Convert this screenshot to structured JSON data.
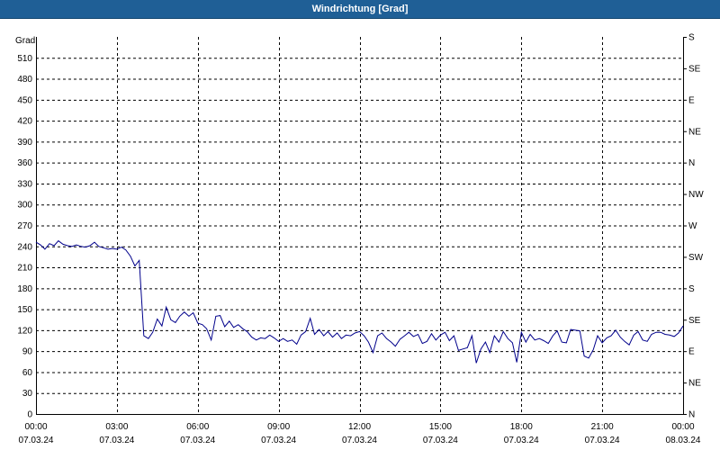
{
  "window": {
    "title": "Windrichtung [Grad]"
  },
  "colors": {
    "line": "#00008b",
    "grid": "#000000",
    "titlebar": "#1f5f96"
  },
  "chart_data": {
    "type": "line",
    "title": "Windrichtung [Grad]",
    "ylabel": "Grad",
    "ylim": [
      0,
      540
    ],
    "y_ticks": [
      0,
      30,
      60,
      90,
      120,
      150,
      180,
      210,
      240,
      270,
      300,
      330,
      360,
      390,
      420,
      450,
      480,
      510
    ],
    "y2_ticks": [
      {
        "value": 0,
        "label": "N"
      },
      {
        "value": 45,
        "label": "NE"
      },
      {
        "value": 90,
        "label": "E"
      },
      {
        "value": 135,
        "label": "SE"
      },
      {
        "value": 180,
        "label": "S"
      },
      {
        "value": 225,
        "label": "SW"
      },
      {
        "value": 270,
        "label": "W"
      },
      {
        "value": 315,
        "label": "NW"
      },
      {
        "value": 360,
        "label": "N"
      },
      {
        "value": 405,
        "label": "NE"
      },
      {
        "value": 450,
        "label": "E"
      },
      {
        "value": 495,
        "label": "SE"
      },
      {
        "value": 540,
        "label": "S"
      }
    ],
    "xlim": [
      0,
      24
    ],
    "x_ticks": [
      {
        "value": 0,
        "time": "00:00",
        "date": "07.03.24"
      },
      {
        "value": 3,
        "time": "03:00",
        "date": "07.03.24"
      },
      {
        "value": 6,
        "time": "06:00",
        "date": "07.03.24"
      },
      {
        "value": 9,
        "time": "09:00",
        "date": "07.03.24"
      },
      {
        "value": 12,
        "time": "12:00",
        "date": "07.03.24"
      },
      {
        "value": 15,
        "time": "15:00",
        "date": "07.03.24"
      },
      {
        "value": 18,
        "time": "18:00",
        "date": "07.03.24"
      },
      {
        "value": 21,
        "time": "21:00",
        "date": "07.03.24"
      },
      {
        "value": 24,
        "time": "00:00",
        "date": "08.03.24"
      }
    ],
    "grid": true,
    "legend": "none",
    "series": [
      {
        "x": [
          0,
          0.17,
          0.33,
          0.5,
          0.67,
          0.83,
          1,
          1.17,
          1.33,
          1.5,
          1.67,
          1.83,
          2,
          2.17,
          2.33,
          2.5,
          2.67,
          2.83,
          3,
          3.17,
          3.33,
          3.5,
          3.67,
          3.83,
          4,
          4.17,
          4.33,
          4.5,
          4.67,
          4.83,
          5,
          5.17,
          5.33,
          5.5,
          5.67,
          5.83,
          6,
          6.17,
          6.33,
          6.5,
          6.67,
          6.83,
          7,
          7.17,
          7.33,
          7.5,
          7.67,
          7.83,
          8,
          8.17,
          8.33,
          8.5,
          8.67,
          8.83,
          9,
          9.17,
          9.33,
          9.5,
          9.67,
          9.83,
          10,
          10.17,
          10.33,
          10.5,
          10.67,
          10.83,
          11,
          11.17,
          11.33,
          11.5,
          11.67,
          11.83,
          12,
          12.17,
          12.33,
          12.5,
          12.67,
          12.83,
          13,
          13.17,
          13.33,
          13.5,
          13.67,
          13.83,
          14,
          14.17,
          14.33,
          14.5,
          14.67,
          14.83,
          15,
          15.17,
          15.33,
          15.5,
          15.67,
          15.83,
          16,
          16.17,
          16.33,
          16.5,
          16.67,
          16.83,
          17,
          17.17,
          17.33,
          17.5,
          17.67,
          17.83,
          18,
          18.17,
          18.33,
          18.5,
          18.67,
          18.83,
          19,
          19.17,
          19.33,
          19.5,
          19.67,
          19.83,
          20,
          20.17,
          20.33,
          20.5,
          20.67,
          20.83,
          21,
          21.17,
          21.33,
          21.5,
          21.67,
          21.83,
          22,
          22.17,
          22.33,
          22.5,
          22.67,
          22.83,
          23,
          23.17,
          23.33,
          23.5,
          23.67,
          23.83,
          24
        ],
        "values": [
          246,
          242,
          236,
          244,
          241,
          248,
          243,
          241,
          240,
          242,
          240,
          239,
          241,
          246,
          240,
          238,
          236,
          237,
          236,
          239,
          235,
          226,
          212,
          220,
          112,
          108,
          117,
          136,
          126,
          153,
          135,
          131,
          140,
          146,
          140,
          145,
          130,
          128,
          122,
          106,
          140,
          141,
          125,
          133,
          124,
          128,
          122,
          118,
          110,
          106,
          109,
          108,
          113,
          109,
          104,
          108,
          104,
          106,
          100,
          113,
          118,
          137,
          114,
          121,
          112,
          118,
          110,
          116,
          108,
          113,
          112,
          116,
          118,
          112,
          103,
          88,
          112,
          116,
          108,
          103,
          97,
          107,
          112,
          117,
          111,
          114,
          101,
          104,
          115,
          106,
          113,
          117,
          105,
          112,
          91,
          93,
          95,
          112,
          73,
          93,
          103,
          88,
          112,
          103,
          118,
          108,
          102,
          74,
          117,
          103,
          114,
          106,
          108,
          105,
          101,
          112,
          119,
          103,
          102,
          121,
          120,
          119,
          83,
          80,
          92,
          112,
          102,
          109,
          112,
          120,
          110,
          104,
          99,
          113,
          118,
          106,
          104,
          114,
          117,
          117,
          114,
          113,
          111,
          116,
          126
        ]
      }
    ]
  }
}
